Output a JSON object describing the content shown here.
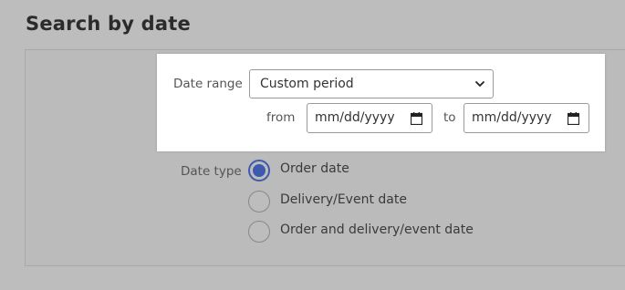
{
  "page": {
    "title": "Search by date"
  },
  "date_range": {
    "label": "Date range",
    "selected": "Custom period",
    "from_label": "from",
    "from_placeholder": "mm/dd/yyyy",
    "to_label": "to",
    "to_placeholder": "mm/dd/yyyy"
  },
  "date_type": {
    "label": "Date type",
    "options": [
      {
        "label": "Order date",
        "checked": true
      },
      {
        "label": "Delivery/Event date",
        "checked": false
      },
      {
        "label": "Order and delivery/event date",
        "checked": false
      }
    ]
  },
  "colors": {
    "accent": "#3d5aae",
    "overlay": "#bdbdbd"
  }
}
